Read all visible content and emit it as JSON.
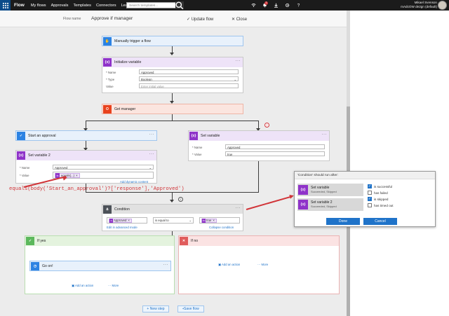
{
  "topbar": {
    "brand": "Flow",
    "nav": [
      "My flows",
      "Approvals",
      "Templates",
      "Connectors",
      "Learn"
    ],
    "search_placeholder": "Search templates...",
    "user_name": "Mikael Svenson",
    "user_org": "mAdcOW de2gn (default)",
    "notif_count": "3",
    "icons": [
      "app-launcher-icon",
      "search-icon",
      "wifi-icon",
      "bell-icon",
      "download-icon",
      "gear-icon",
      "help-icon"
    ]
  },
  "subbar": {
    "flow_name_label": "Flow name",
    "flow_name": "Approve if manager",
    "update_label": "Update flow",
    "close_label": "Close"
  },
  "steps": {
    "trigger": {
      "title": "Manually trigger a flow",
      "icon": "hand-icon",
      "color": "#2b82e3"
    },
    "init_var": {
      "title": "Initialize variable",
      "icon": "variable-icon",
      "color": "#8f33c9",
      "name_label": "* Name",
      "name_value": "Approved",
      "type_label": "* Type",
      "type_value": "Boolean",
      "value_label": "Value",
      "value_placeholder": "Enter initial value"
    },
    "get_manager": {
      "title": "Get manager",
      "icon": "office-icon",
      "color": "#e8421d"
    },
    "start_approval": {
      "title": "Start an approval",
      "icon": "approval-icon",
      "color": "#2b82e3"
    },
    "set_var2": {
      "title": "Set variable 2",
      "name_label": "* Name",
      "name_value": "Approved",
      "value_label": "* Value",
      "token": "equals(...)",
      "dynamic_link": "Add dynamic content"
    },
    "set_var": {
      "title": "Set variable",
      "name_label": "* Name",
      "name_value": "Approved",
      "value_label": "* Value",
      "value_value": "true"
    },
    "condition": {
      "title": "Condition",
      "token_left": "Approved",
      "operator": "is equal to",
      "token_right": "true",
      "advanced_link": "Edit in advanced mode",
      "collapse_link": "Collapse condition"
    },
    "if_yes": {
      "title": "If yes",
      "action_title": "Go on!",
      "add_action": "Add an action",
      "more": "More"
    },
    "if_no": {
      "title": "If no",
      "add_action": "Add an action",
      "more": "More"
    }
  },
  "expression": "equals(body('Start_an_approval')?['response'],'Approved')",
  "bottom": {
    "new_step": "+ New step",
    "save": "Save flow"
  },
  "dialog": {
    "title": "'Condition' should run after:",
    "items": [
      {
        "name": "Set variable",
        "status": "Succeeded, Skipped"
      },
      {
        "name": "Set variable 2",
        "status": "Succeeded, Skipped"
      }
    ],
    "options": [
      {
        "label": "is successful",
        "checked": true
      },
      {
        "label": "has failed",
        "checked": false
      },
      {
        "label": "is skipped",
        "checked": true
      },
      {
        "label": "has timed out",
        "checked": false
      }
    ],
    "done": "Done",
    "cancel": "Cancel"
  }
}
